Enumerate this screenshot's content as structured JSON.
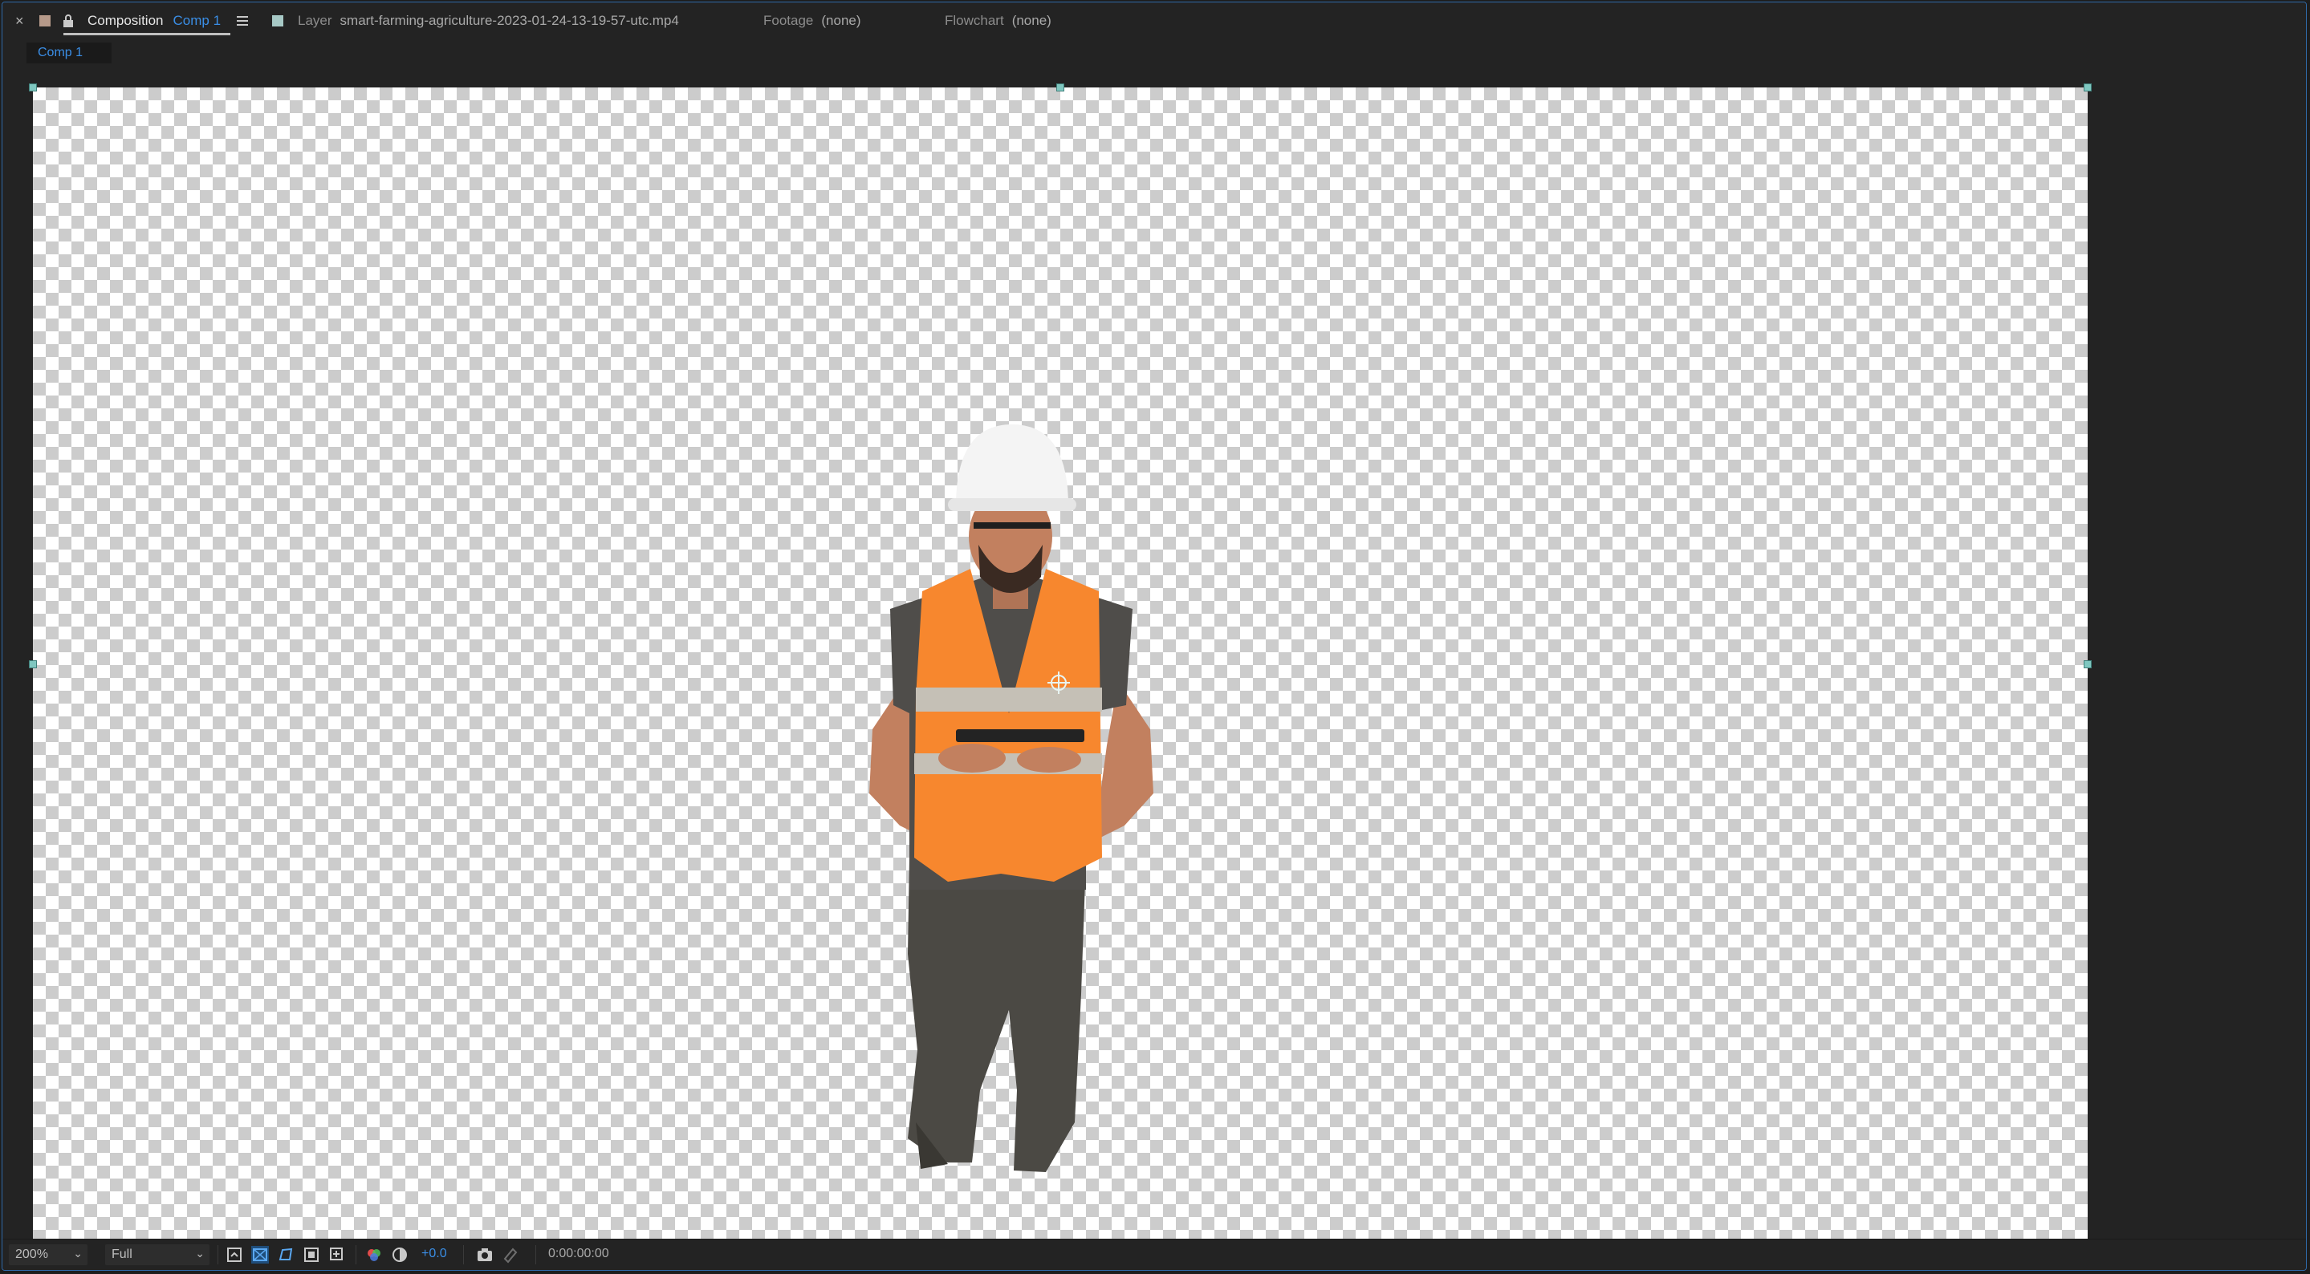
{
  "tabs": {
    "composition": {
      "close_glyph": "×",
      "kind": "Composition",
      "name": "Comp 1",
      "label_color": "#b69a8a",
      "accent": "#3a8ee6"
    },
    "layer": {
      "kind": "Layer",
      "name": "smart-farming-agriculture-2023-01-24-13-19-57-utc.mp4",
      "label_color": "#a7c9c6"
    },
    "footage": {
      "kind": "Footage",
      "value": "(none)"
    },
    "flowchart": {
      "kind": "Flowchart",
      "value": "(none)"
    }
  },
  "composition_nav": {
    "item": "Comp 1"
  },
  "viewer": {
    "transparency_grid": true,
    "subject": "worker-in-hardhat-and-safety-vest-holding-tablet"
  },
  "bottom_bar": {
    "magnification": "200%",
    "resolution": "Full",
    "exposure": "+0.0",
    "timecode": "0:00:00:00",
    "icons": [
      "preview-time-icon",
      "transparency-grid-icon",
      "mask-path-icon",
      "region-of-interest-icon",
      "grid-guides-icon",
      "color-channels-icon",
      "reset-exposure-icon",
      "snapshot-icon",
      "show-snapshot-icon"
    ]
  }
}
